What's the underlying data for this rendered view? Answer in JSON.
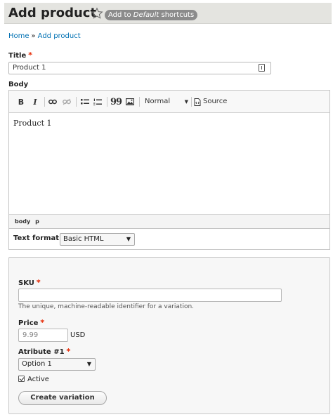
{
  "header": {
    "title": "Add product",
    "shortcut_prefix": "Add to ",
    "shortcut_set": "Default",
    "shortcut_suffix": " shortcuts"
  },
  "breadcrumb": {
    "home": "Home",
    "separator": "»",
    "current": "Add product"
  },
  "title_field": {
    "label": "Title",
    "required_marker": "*",
    "value": "Product 1"
  },
  "body_field": {
    "label": "Body",
    "toolbar": {
      "bold": "B",
      "italic": "I",
      "blockquote": "99",
      "format_value": "Normal",
      "source_label": "Source"
    },
    "content": "Product 1",
    "path": [
      "body",
      "p"
    ],
    "text_format_label": "Text format",
    "text_format_value": "Basic HTML"
  },
  "variation": {
    "sku": {
      "label": "SKU",
      "required_marker": "*",
      "value": "",
      "description": "The unique, machine-readable identifier for a variation."
    },
    "price": {
      "label": "Price",
      "required_marker": "*",
      "placeholder": "9.99",
      "currency": "USD"
    },
    "attribute": {
      "label": "Atribute #1",
      "required_marker": "*",
      "value": "Option 1"
    },
    "active": {
      "label": "Active",
      "checked": true
    },
    "create_button": "Create variation"
  },
  "colors": {
    "link": "#0071b3",
    "required": "#e62600",
    "header_bg": "#e4e4e0",
    "badge_bg": "#8b8b8b"
  },
  "icons": [
    "star-icon",
    "autofill-icon",
    "link-icon",
    "unlink-icon",
    "bulleted-list-icon",
    "numbered-list-icon",
    "image-icon",
    "source-icon"
  ]
}
